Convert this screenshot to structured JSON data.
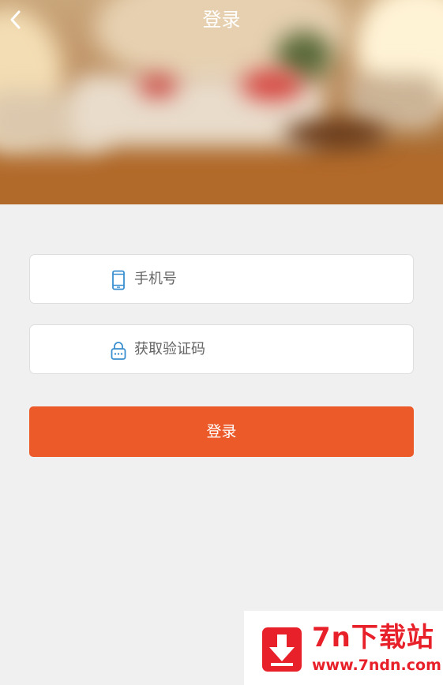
{
  "header": {
    "title": "登录",
    "back_icon": "chevron-left-icon"
  },
  "form": {
    "phone": {
      "placeholder": "手机号",
      "value": "",
      "icon": "phone-icon"
    },
    "code": {
      "placeholder": "获取验证码",
      "value": "",
      "icon": "lock-icon"
    },
    "submit_label": "登录"
  },
  "watermark": {
    "name": "7n下载站",
    "url": "www.7ndn.com",
    "icon": "download-arrow-icon"
  },
  "colors": {
    "accent": "#ec5a2a",
    "icon_blue": "#3a8fd0",
    "background": "#f0f0f0",
    "watermark_red": "#e8202a"
  }
}
